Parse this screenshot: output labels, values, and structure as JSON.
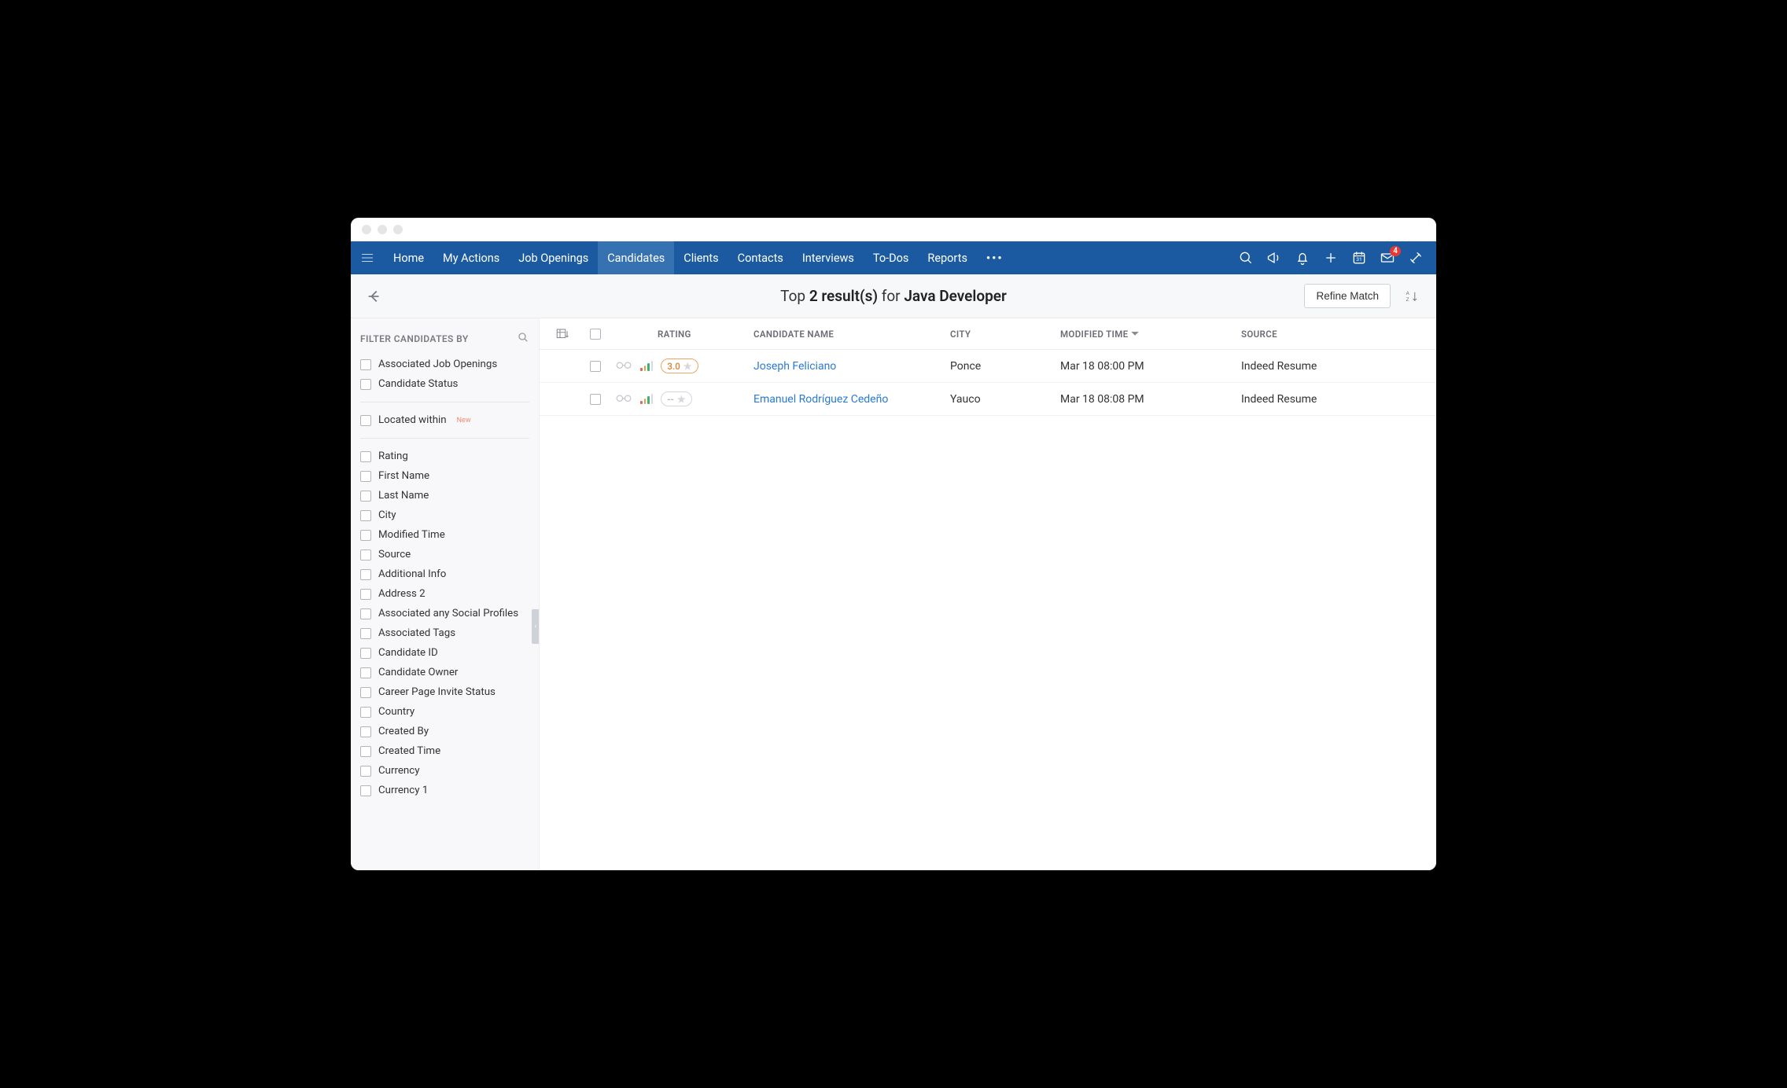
{
  "nav": {
    "items": [
      "Home",
      "My Actions",
      "Job Openings",
      "Candidates",
      "Clients",
      "Contacts",
      "Interviews",
      "To-Dos",
      "Reports"
    ],
    "active_index": 3,
    "mail_badge": "4"
  },
  "subheader": {
    "prefix": "Top",
    "count": "2 result(s)",
    "for_label": "for",
    "target": "Java Developer",
    "refine_button": "Refine Match"
  },
  "sidebar": {
    "title": "FILTER CANDIDATES BY",
    "group1": [
      "Associated Job Openings",
      "Candidate Status"
    ],
    "located_within": "Located within",
    "new_tag": "New",
    "group2": [
      "Rating",
      "First Name",
      "Last Name",
      "City",
      "Modified Time",
      "Source",
      "Additional Info",
      "Address 2",
      "Associated any Social Profiles",
      "Associated Tags",
      "Candidate ID",
      "Candidate Owner",
      "Career Page Invite Status",
      "Country",
      "Created By",
      "Created Time",
      "Currency",
      "Currency 1"
    ]
  },
  "table": {
    "headers": {
      "rating": "RATING",
      "name": "CANDIDATE NAME",
      "city": "CITY",
      "modtime": "MODIFIED TIME",
      "source": "SOURCE"
    },
    "rows": [
      {
        "name": "Joseph Feliciano",
        "city": "Ponce",
        "modtime": "Mar 18 08:00 PM",
        "source": "Indeed Resume",
        "rating": "3.0"
      },
      {
        "name": "Emanuel Rodríguez Cedeño",
        "city": "Yauco",
        "modtime": "Mar 18 08:08 PM",
        "source": "Indeed Resume",
        "rating": "--"
      }
    ]
  }
}
